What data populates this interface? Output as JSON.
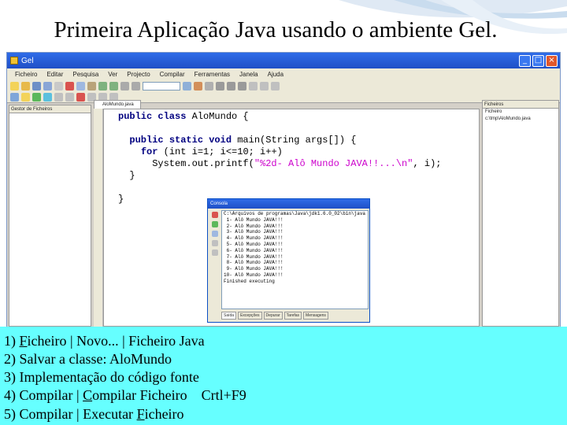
{
  "slide": {
    "title": "Primeira Aplicação Java usando o ambiente Gel."
  },
  "ide": {
    "window_title": "Gel",
    "menu": [
      "Ficheiro",
      "Editar",
      "Pesquisa",
      "Ver",
      "Projecto",
      "Compilar",
      "Ferramentas",
      "Janela",
      "Ajuda"
    ],
    "left_pane_title": "Gestor de Ficheiros",
    "editor_tab": "AloMundo.java",
    "right_pane_title": "Ficheiros",
    "right_pane_items": [
      "Ficheiro",
      "c:\\tmp\\AloMundo.java"
    ],
    "code_lines": [
      [
        {
          "t": "public class ",
          "c": "kw"
        },
        {
          "t": "AloMundo {",
          "c": ""
        }
      ],
      [
        {
          "t": "",
          "c": ""
        }
      ],
      [
        {
          "t": "  ",
          "c": ""
        },
        {
          "t": "public static void ",
          "c": "kw"
        },
        {
          "t": "main(String args[]) {",
          "c": ""
        }
      ],
      [
        {
          "t": "    ",
          "c": ""
        },
        {
          "t": "for ",
          "c": "kw"
        },
        {
          "t": "(int i=1; i<=10; i++)",
          "c": ""
        }
      ],
      [
        {
          "t": "      System.out.printf(",
          "c": ""
        },
        {
          "t": "\"%2d- Alô Mundo JAVA!!...\\n\"",
          "c": "str"
        },
        {
          "t": ", i);",
          "c": ""
        }
      ],
      [
        {
          "t": "  }",
          "c": ""
        }
      ],
      [
        {
          "t": "",
          "c": ""
        }
      ],
      [
        {
          "t": "}",
          "c": ""
        }
      ]
    ]
  },
  "console": {
    "title": "Consola",
    "lines": [
      "C:\\Arquivos de programas\\Java\\jdk1.6.0_02\\bin\\java",
      " 1- Alô Mundo JAVA!!!",
      " 2- Alô Mundo JAVA!!!",
      " 3- Alô Mundo JAVA!!!",
      " 4- Alô Mundo JAVA!!!",
      " 5- Alô Mundo JAVA!!!",
      " 6- Alô Mundo JAVA!!!",
      " 7- Alô Mundo JAVA!!!",
      " 8- Alô Mundo JAVA!!!",
      " 9- Alô Mundo JAVA!!!",
      "10- Alô Mundo JAVA!!!",
      "Finished executing"
    ],
    "tabs": [
      "Saída",
      "Excepções",
      "Depurar",
      "Tarefas",
      "Mensagens"
    ]
  },
  "steps": [
    {
      "n": "1) ",
      "u": "F",
      "rest": "icheiro | Novo... | Ficheiro Java"
    },
    {
      "n": "2) Salvar a classe: AloMundo",
      "u": "",
      "rest": ""
    },
    {
      "n": "3) Implementação do código fonte",
      "u": "",
      "rest": ""
    },
    {
      "n": "4) Compilar | ",
      "u": "C",
      "rest": "ompilar Ficheiro    Crtl+F9"
    },
    {
      "n": "5) Compilar | Executar ",
      "u": "F",
      "rest": "icheiro"
    }
  ],
  "colors": {
    "steps_bg": "#66ffff",
    "titlebar": "#1f4fc6",
    "keyword": "#000080",
    "string": "#cc00cc"
  }
}
